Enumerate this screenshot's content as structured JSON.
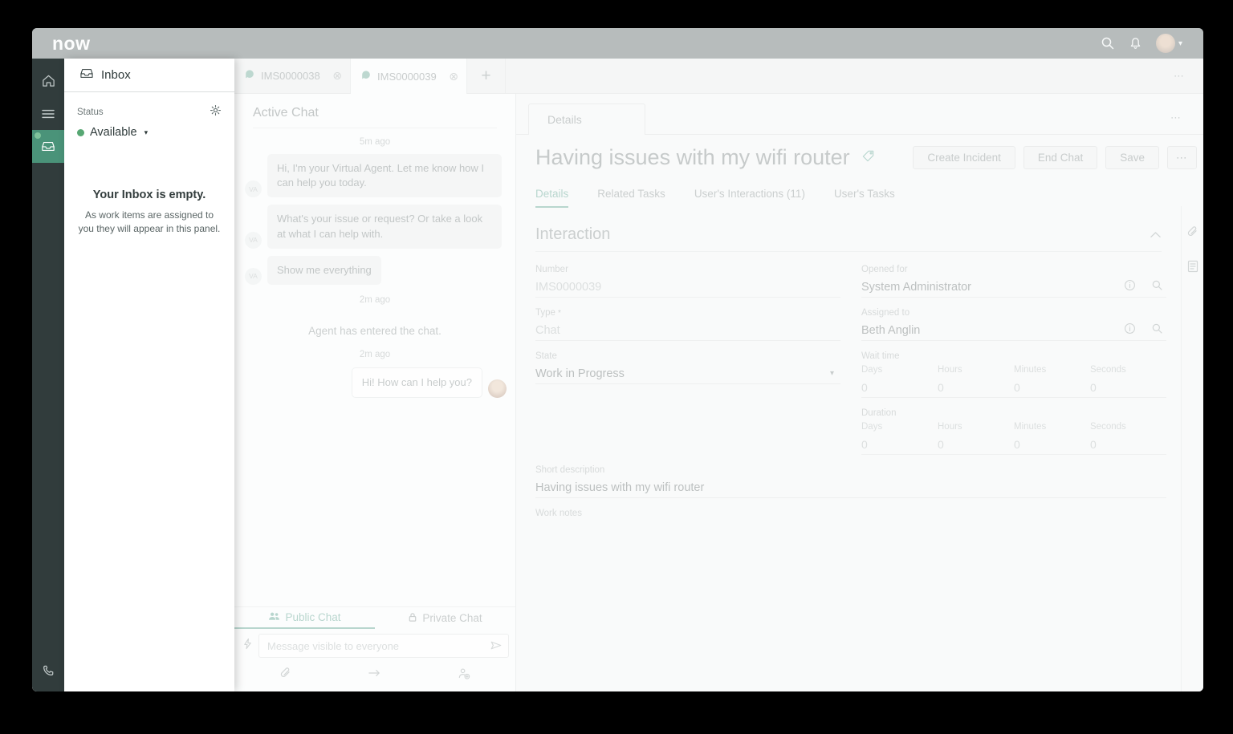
{
  "header": {
    "logo": "now"
  },
  "inbox": {
    "title": "Inbox",
    "status_label": "Status",
    "status_value": "Available",
    "empty_title": "Your Inbox is empty.",
    "empty_text": "As work items are assigned to you they will appear in this panel."
  },
  "chat": {
    "tabs": [
      {
        "label": "IMS0000038"
      },
      {
        "label": "IMS0000039"
      }
    ],
    "close_glyph": "⊗",
    "new_tab_label": "+",
    "more_label": "⋯",
    "panel_title": "Active Chat",
    "timestamps": [
      "5m ago",
      "2m ago",
      "2m ago"
    ],
    "va_label": "VA",
    "va_messages": [
      "Hi, I'm your Virtual Agent. Let me know how I can help you today.",
      "What's your issue or request? Or take a look at what I can help with.",
      "Show me everything"
    ],
    "system_message": "Agent has entered the chat.",
    "agent_message": "Hi! How can I help you?",
    "footer": {
      "public_tab": "Public Chat",
      "private_tab": "Private Chat",
      "input_placeholder": "Message visible to everyone"
    }
  },
  "details": {
    "top_tab": "Details",
    "more_label": "⋯",
    "title": "Having issues with my wifi router",
    "actions": [
      "Create Incident",
      "End Chat",
      "Save"
    ],
    "overflow_label": "⋯",
    "subtabs": [
      "Details",
      "Related Tasks",
      "User's Interactions (11)",
      "User's Tasks"
    ],
    "section_title": "Interaction",
    "form": {
      "number_label": "Number",
      "number_value": "IMS0000039",
      "type_label": "Type",
      "type_required": "*",
      "type_value": "Chat",
      "state_label": "State",
      "state_value": "Work in Progress",
      "state_caret": "▾",
      "opened_for_label": "Opened for",
      "opened_for_value": "System Administrator",
      "assigned_to_label": "Assigned to",
      "assigned_to_value": "Beth Anglin",
      "wait_time_label": "Wait time",
      "duration_label": "Duration",
      "time_columns": [
        "Days",
        "Hours",
        "Minutes",
        "Seconds"
      ],
      "wait_values": [
        "0",
        "0",
        "0",
        "0"
      ],
      "duration_values": [
        "0",
        "0",
        "0",
        "0"
      ],
      "short_description_label": "Short description",
      "short_description_value": "Having issues with my wifi router",
      "work_notes_label": "Work notes"
    }
  },
  "status_misc": {
    "available_caret": "▾"
  },
  "colors": {
    "accent_teal": "#2f8670",
    "nav_active_green": "#4a9379",
    "status_green": "#57a773",
    "header_dark": "#2c3d3d"
  }
}
